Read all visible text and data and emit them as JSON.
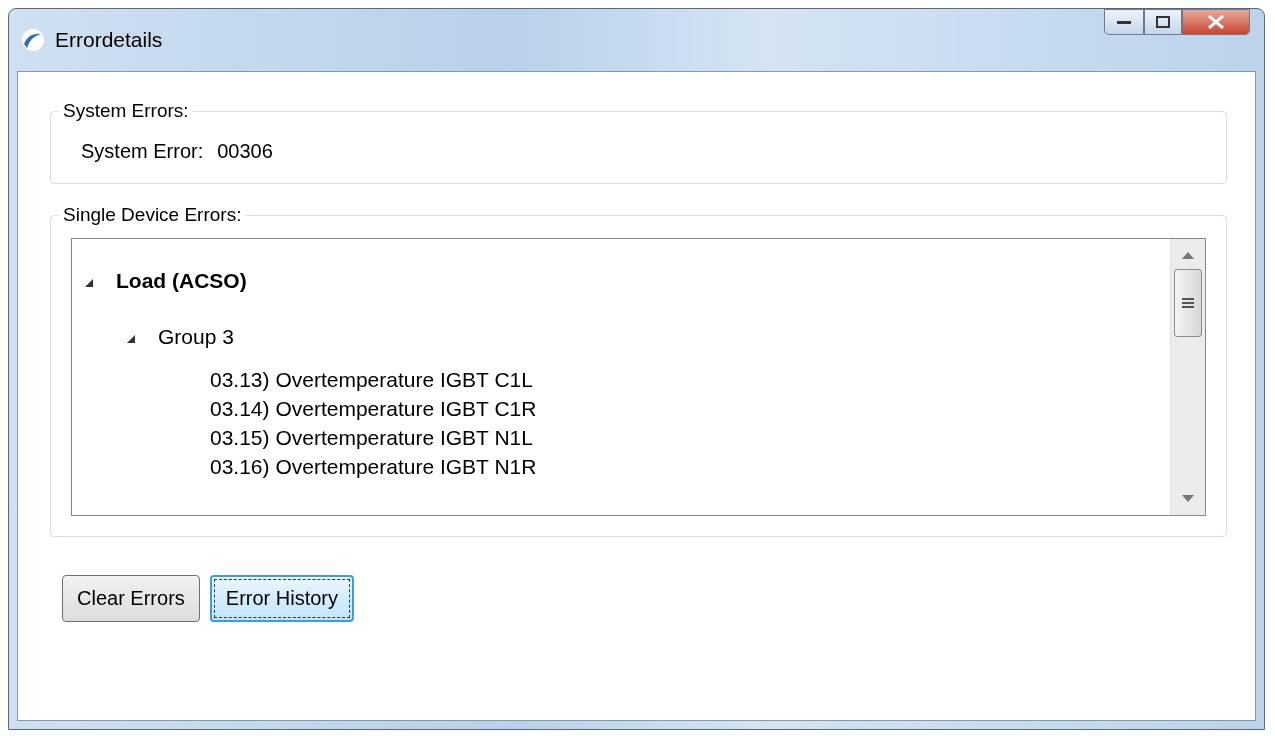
{
  "window": {
    "title": "Errordetails"
  },
  "system_errors": {
    "title": "System Errors:",
    "label": "System Error:",
    "value": "00306"
  },
  "device_errors": {
    "title": "Single Device Errors:",
    "tree": [
      {
        "label": "Load (ACSO)",
        "expanded": true,
        "children": [
          {
            "label": "Group 3",
            "expanded": true,
            "children": [
              {
                "label": "03.13) Overtemperature IGBT C1L"
              },
              {
                "label": "03.14) Overtemperature IGBT C1R"
              },
              {
                "label": "03.15) Overtemperature IGBT N1L"
              },
              {
                "label": "03.16) Overtemperature IGBT N1R"
              }
            ]
          }
        ]
      }
    ]
  },
  "buttons": [
    {
      "label": "Clear Errors",
      "focused": false
    },
    {
      "label": "Error History",
      "focused": true
    }
  ]
}
